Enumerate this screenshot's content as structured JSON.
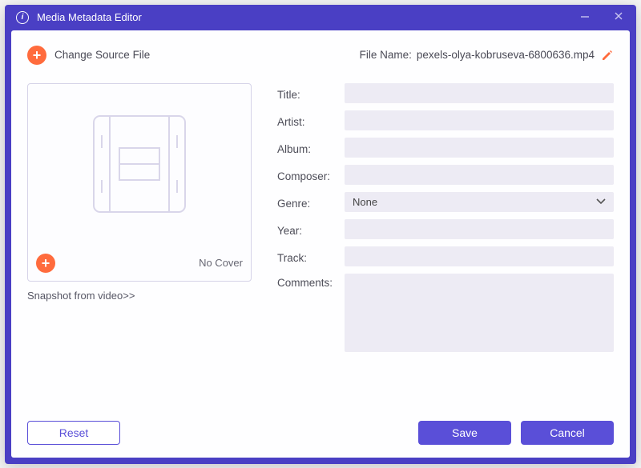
{
  "window": {
    "title": "Media Metadata Editor"
  },
  "source": {
    "change_label": "Change Source File",
    "file_name_label": "File Name:",
    "file_name": "pexels-olya-kobruseva-6800636.mp4"
  },
  "cover": {
    "no_cover_label": "No Cover",
    "snapshot_label": "Snapshot from video>>"
  },
  "fields": {
    "title_label": "Title:",
    "title_value": "",
    "artist_label": "Artist:",
    "artist_value": "",
    "album_label": "Album:",
    "album_value": "",
    "composer_label": "Composer:",
    "composer_value": "",
    "genre_label": "Genre:",
    "genre_value": "None",
    "year_label": "Year:",
    "year_value": "",
    "track_label": "Track:",
    "track_value": "",
    "comments_label": "Comments:",
    "comments_value": ""
  },
  "buttons": {
    "reset": "Reset",
    "save": "Save",
    "cancel": "Cancel"
  }
}
